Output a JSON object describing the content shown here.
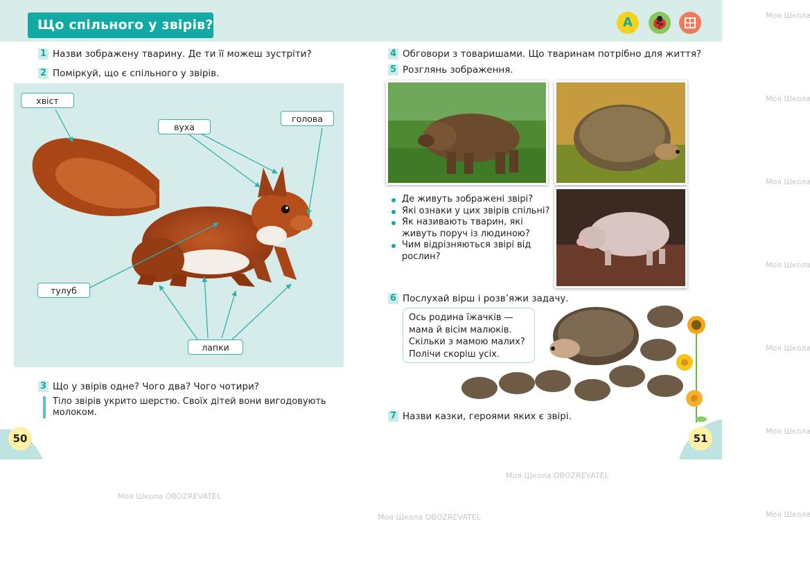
{
  "left_page": {
    "title": "Що спільного у звірів?",
    "task1_num": "1",
    "task1_text": "Назви зображену тварину. Де ти її можеш зустріти?",
    "task2_num": "2",
    "task2_text": "Поміркуй, що є спільного у звірів.",
    "labels": {
      "tail": "хвіст",
      "ears": "вуха",
      "head": "голова",
      "body": "тулуб",
      "paws": "лапки"
    },
    "task3_num": "3",
    "task3_text": "Що у звірів одне? Чого два? Чого чотири?",
    "task3_answer": "Тіло звірів укрито шерстю. Своїх дітей вони вигодовують молоком.",
    "page_number": "50"
  },
  "right_page": {
    "task4_num": "4",
    "task4_text": "Обговори з товаришами. Що тваринам потрібно для життя?",
    "task5_num": "5",
    "task5_text": "Розглянь зображення.",
    "bullets": [
      "Де живуть зображені звірі?",
      "Які ознаки у цих звірів спільні?",
      "Як називають тварин, які живуть поруч із людиною?",
      "Чим відрізняються звірі від рослин?"
    ],
    "task6_num": "6",
    "task6_text": "Послухай вірш і розв’яжи задачу.",
    "poem_lines": [
      "Ось родина їжачків —",
      "мама й вісім малюків.",
      "Скільки з мамою малих?",
      "Полічи скоріш усіх."
    ],
    "task7_num": "7",
    "task7_text": "Назви казки, героями яких є звірі.",
    "page_number": "51"
  },
  "header_icons": {
    "letter": "A",
    "names": [
      "letter-a-icon",
      "ladybug-icon",
      "grid-icon"
    ]
  },
  "watermark": {
    "brand": "Моя Школа",
    "partner": "OBOZREVATEL"
  },
  "colors": {
    "accent": "#13a9a4",
    "panel": "#d6ecea",
    "header": "#d8ecea"
  }
}
